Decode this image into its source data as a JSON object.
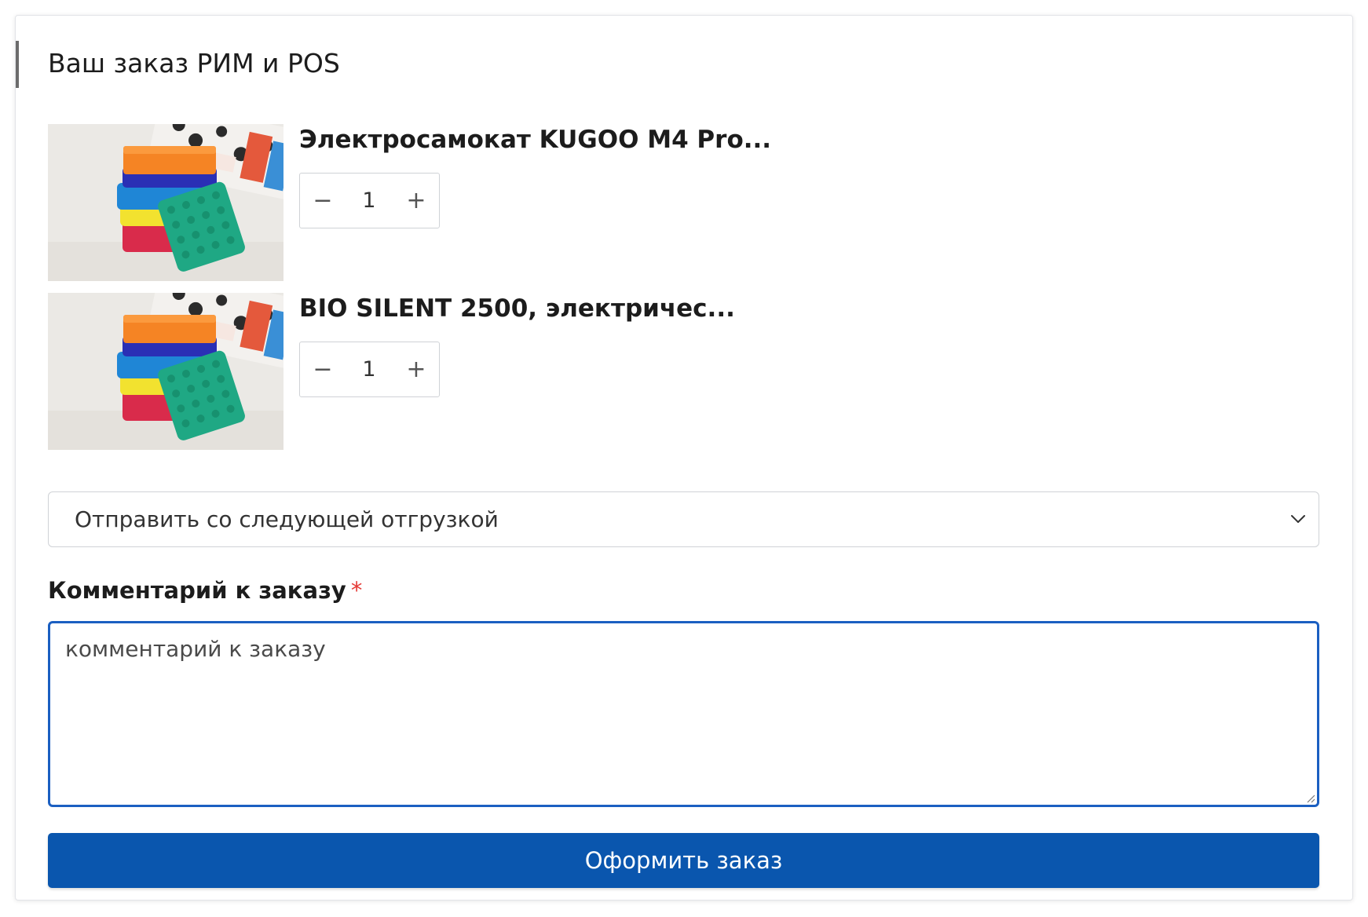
{
  "order": {
    "title": "Ваш заказ РИМ и POS"
  },
  "products": [
    {
      "name": "Электросамокат KUGOO M4 Pro...",
      "quantity": "1",
      "minus_symbol": "−",
      "plus_symbol": "+",
      "image_icon": "sponges-product-image"
    },
    {
      "name": "BIO SILENT 2500, электричес...",
      "quantity": "1",
      "minus_symbol": "−",
      "plus_symbol": "+",
      "image_icon": "sponges-product-image"
    }
  ],
  "shipping": {
    "selected": "Отправить со следующей отгрузкой",
    "icon": "chevron-down-icon"
  },
  "comment": {
    "label": "Комментарий к заказу",
    "required_mark": "*",
    "placeholder": "комментарий к заказу"
  },
  "submit": {
    "label": "Оформить заказ"
  },
  "colors": {
    "accent": "#0a56ae",
    "focus_border": "#1b5fc1",
    "required": "#e53935"
  }
}
